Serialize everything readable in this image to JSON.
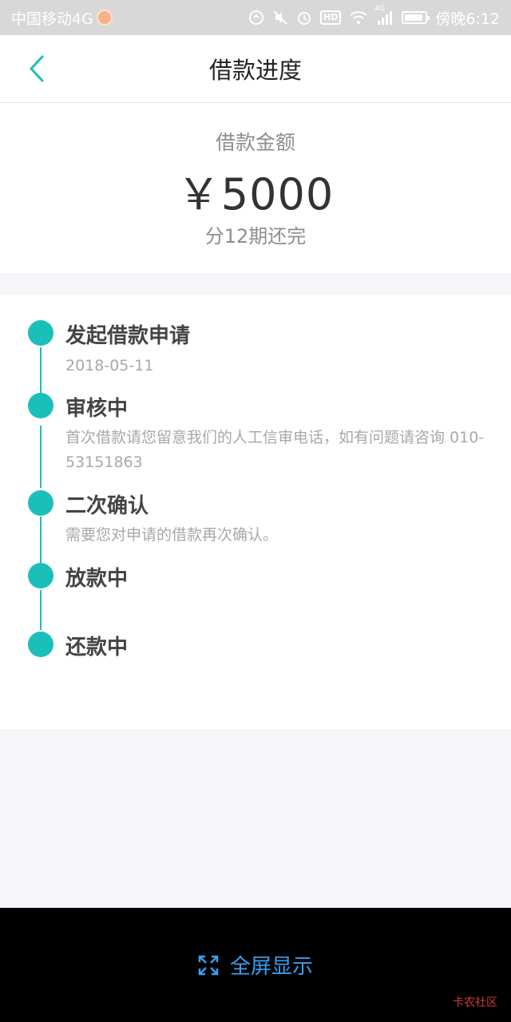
{
  "status_bar": {
    "carrier": "中国移动4G",
    "time": "傍晚6:12",
    "icons": [
      "data-saver-icon",
      "mute-icon",
      "alarm-icon",
      "hd-icon",
      "wifi-icon",
      "signal-icon",
      "battery-icon"
    ],
    "hd_label": "HD",
    "network_label": "4G"
  },
  "nav": {
    "title": "借款进度",
    "back_icon": "chevron-left-icon",
    "accent_color": "#1bbfb9"
  },
  "loan": {
    "amount_label": "借款金额",
    "amount_value": "￥5000",
    "terms": "分12期还完"
  },
  "timeline": {
    "dot_color": "#1bbfb9",
    "steps": [
      {
        "title": "发起借款申请",
        "desc": "2018-05-11"
      },
      {
        "title": "审核中",
        "desc": "首次借款请您留意我们的人工信审电话，如有问题请咨询 010-53151863"
      },
      {
        "title": "二次确认",
        "desc": "需要您对申请的借款再次确认。"
      },
      {
        "title": "放款中",
        "desc": ""
      },
      {
        "title": "还款中",
        "desc": ""
      }
    ]
  },
  "bottom": {
    "fullscreen_label": "全屏显示",
    "fullscreen_icon": "expand-icon",
    "label_color": "#3a9ff0"
  },
  "watermark": {
    "text": "卡农社区"
  }
}
